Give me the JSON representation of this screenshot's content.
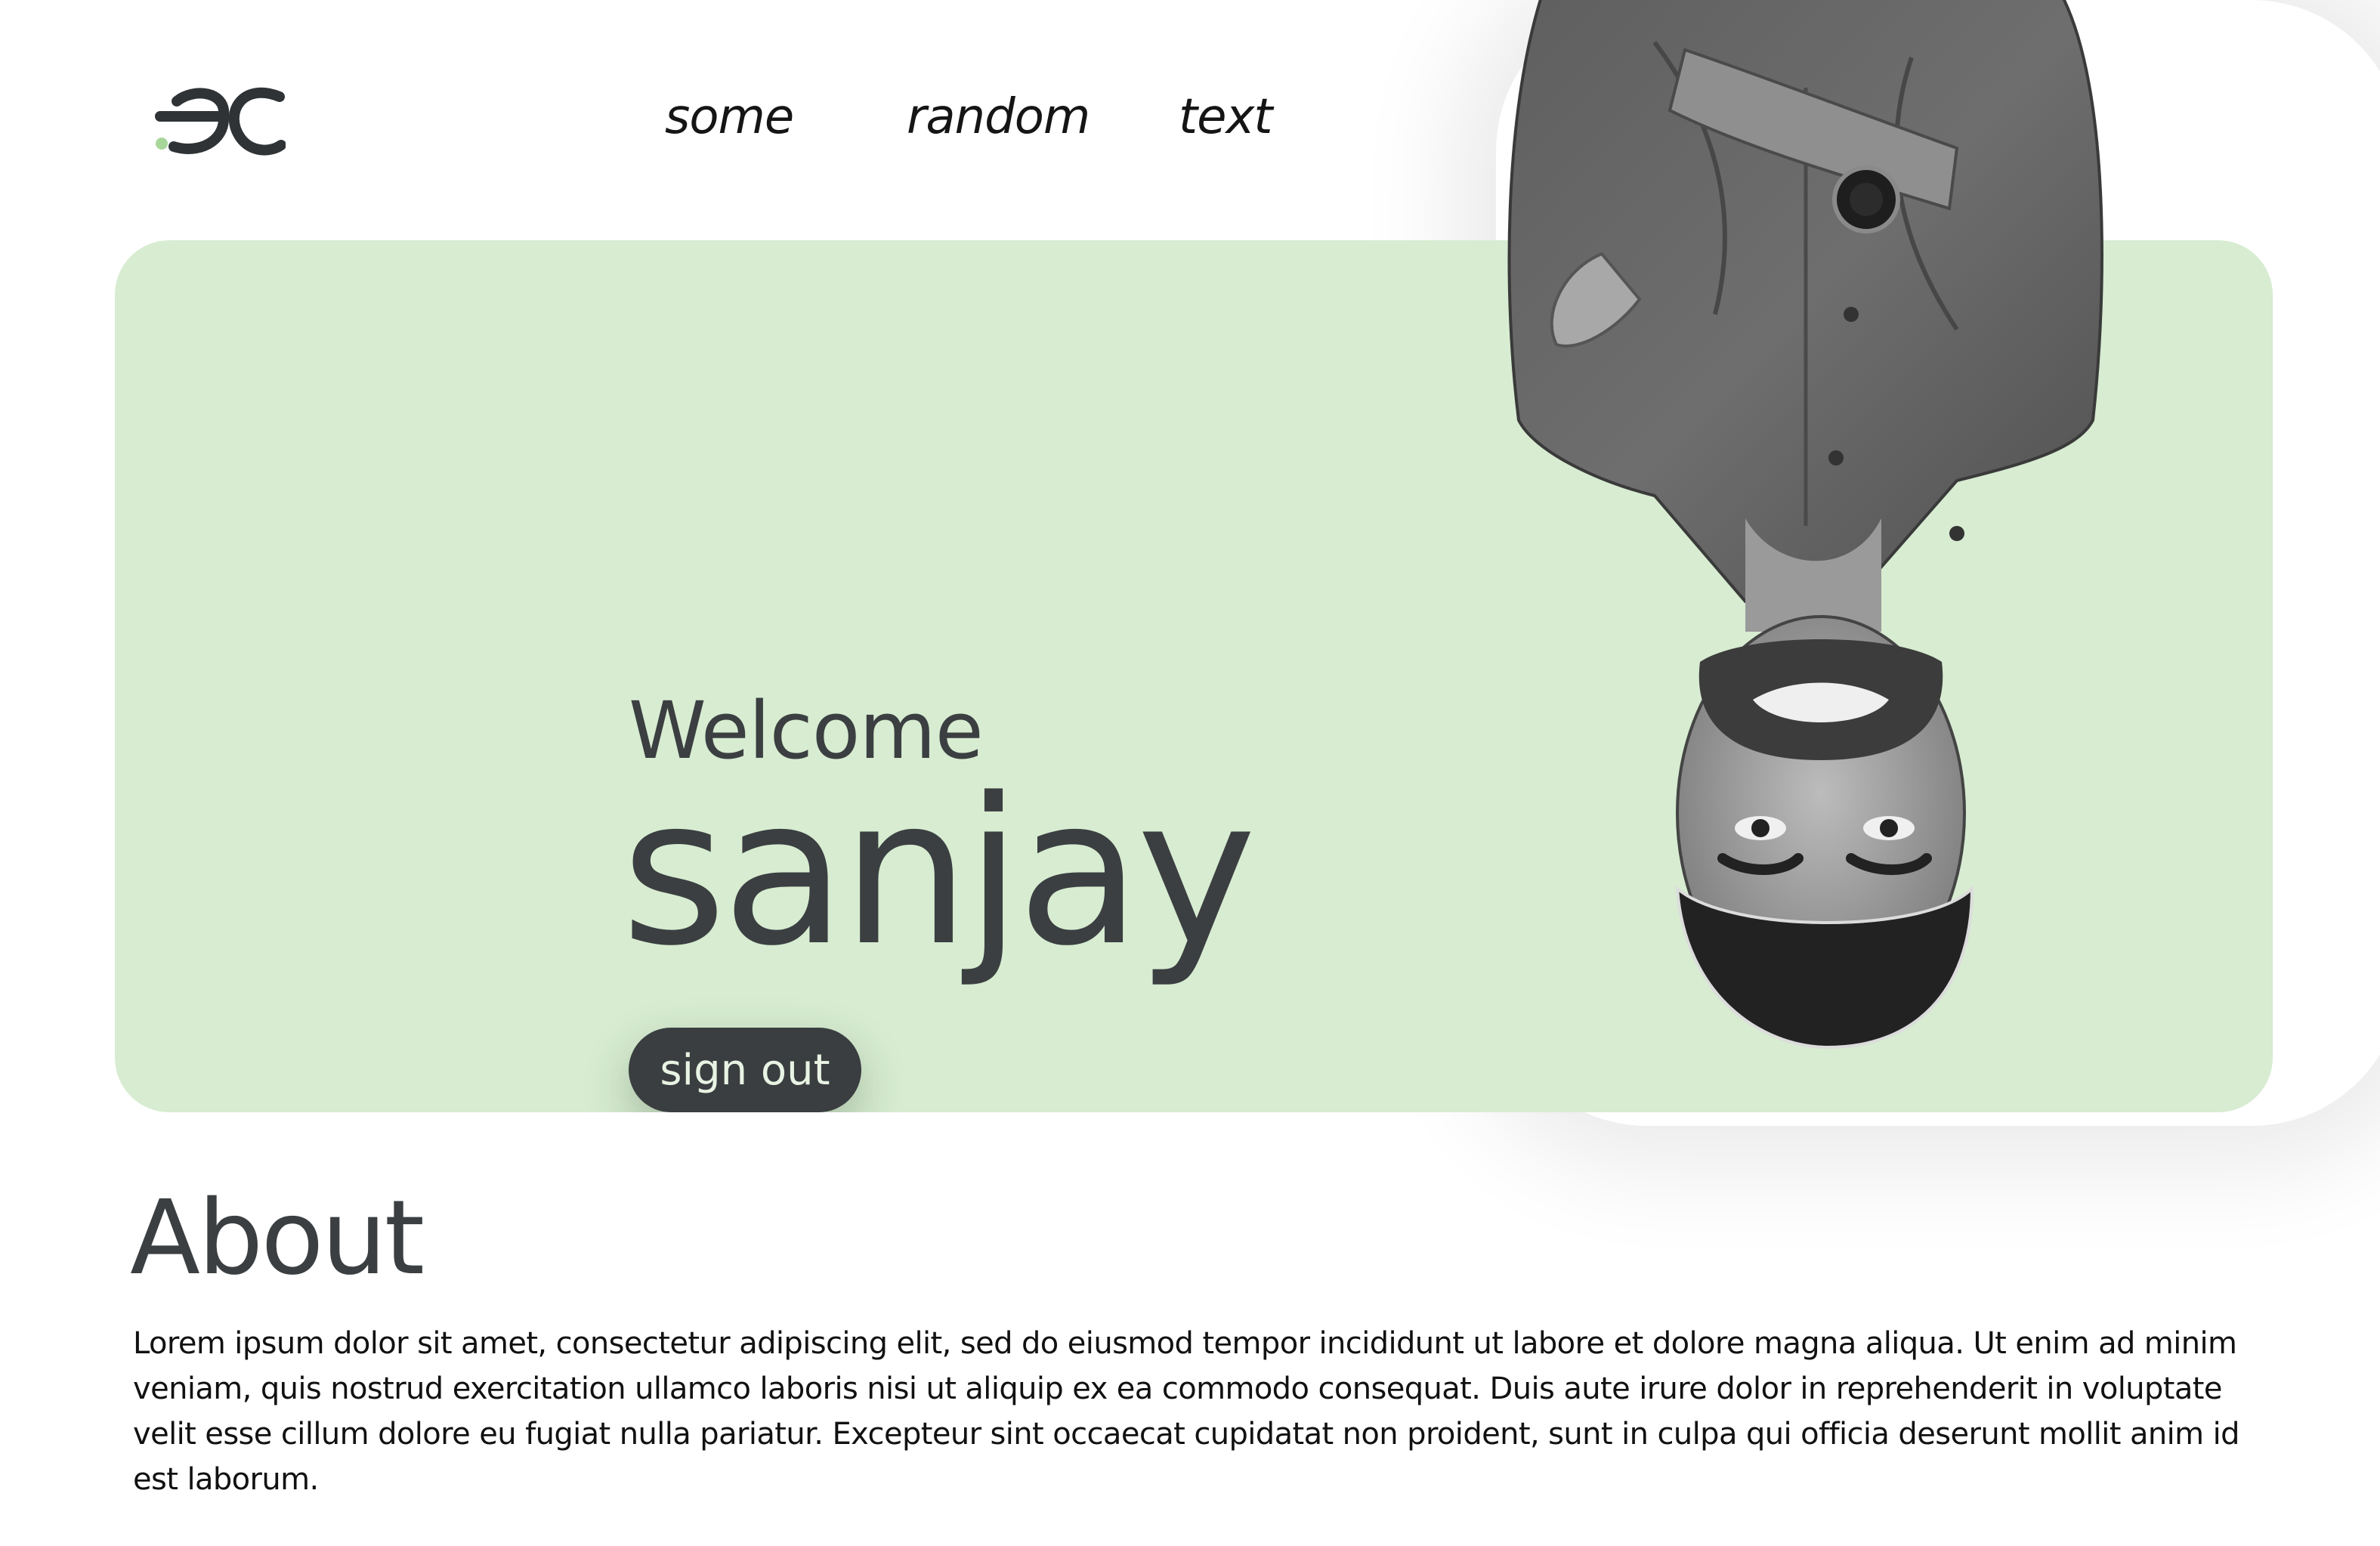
{
  "logo": {
    "name": "ec-logo",
    "accent": "#a8d69a",
    "ink": "#2f3336"
  },
  "nav": {
    "items": [
      "some",
      "random",
      "text"
    ]
  },
  "hero": {
    "background": "#d7ecd1",
    "welcome": "Welcome",
    "name": "sanjay",
    "signout_label": "sign out"
  },
  "about": {
    "title": "About",
    "body": "Lorem ipsum dolor sit amet, consectetur adipiscing elit, sed do eiusmod tempor incididunt ut labore et dolore magna aliqua. Ut enim ad minim veniam, quis nostrud exercitation ullamco laboris nisi ut aliquip ex ea commodo consequat. Duis aute irure dolor in reprehenderit in voluptate velit esse cillum dolore eu fugiat nulla pariatur. Excepteur sint occaecat cupidatat non proident, sunt in culpa qui officia deserunt mollit anim id est laborum."
  }
}
